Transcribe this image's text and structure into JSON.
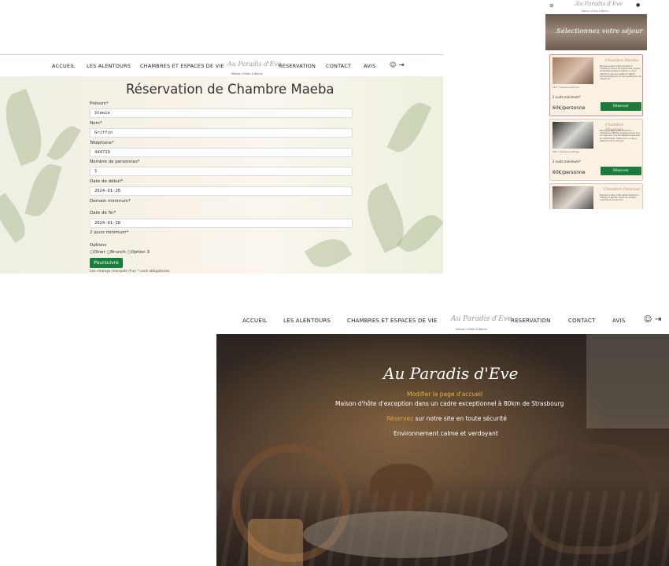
{
  "nav": {
    "items": [
      "ACCUEIL",
      "LES ALENTOURS",
      "CHAMBRES ET ESPACES DE VIE",
      "RESERVATION",
      "CONTACT",
      "AVIS"
    ],
    "logo": "Au Paradis d'Eve",
    "logo_sub": "Maison d'hôte à Bâche",
    "account_icon": "user-circle-icon",
    "logout_icon": "logout-icon"
  },
  "form": {
    "title": "Réservation de Chambre Maeba",
    "fields": [
      {
        "label": "Prénom*",
        "value": "Stewie"
      },
      {
        "label": "Nom*",
        "value": "Griffin"
      },
      {
        "label": "Téléphone*",
        "value": "444719"
      },
      {
        "label": "Nombre de personnes*",
        "value": "1"
      },
      {
        "label": "Date de début*",
        "value": "2024-01-26"
      },
      {
        "label": "Date de fin*",
        "value": "2024-01-28"
      }
    ],
    "hint_start": "Demain minimum*",
    "hint_end": "2 jours minimum*",
    "options_label": "Options",
    "options": [
      "Diner",
      "Brunch",
      "Option 3"
    ],
    "submit": "Poursuivre",
    "footnote": "Les champs marqués d'un * sont obligatoires"
  },
  "mobile": {
    "menu_icon": "hamburger-icon",
    "logo": "Au Paradis d'Eve",
    "logo_sub": "Maison d'hôte à Bâche",
    "hero_title": "Sélectionnez votre séjour",
    "cards": [
      {
        "title": "Chambre Maeba",
        "meta": "19m²   1 personne   wifi logo",
        "min": "2 nuits minimum*",
        "price": "60€/personne",
        "button": "Réserver",
        "text": "Bienvenue dans cette chambre à l'ambiance douce et chaleureuse. Signée de teintes boisées et vieillie, un écrin naturel où des tons sable se mêlent harmonieusement. Un lieu parfait pour se ressourcer."
      },
      {
        "title": "Chambre Magnolia",
        "meta": "20m²   1 personne   wifi logo",
        "min": "2 nuits minimum*",
        "price": "60€/personne",
        "button": "Réserver",
        "text": "Bienvenue dans cette chambre à l'ambiance raffinée, baignée par les tons du magnolia. Une atmosphère apaisante et sophistiquée, idéale pour un séjour détente tout en douceur."
      },
      {
        "title": "Chambre Douceur",
        "meta": "",
        "min": "",
        "price": "",
        "button": "",
        "text": "Bienvenue dans cette petite chambre à l'élégance épurée, pleine de lumière naturelle et de douceur."
      }
    ]
  },
  "home": {
    "title": "Au Paradis d'Eve",
    "edit_link": "Modifier la page d'accueil",
    "line2": "Maison d'hôte d'exception dans un cadre exceptionnel à 80km de Strasbourg",
    "line3_accent": "Réservez",
    "line3_rest": " sur notre site en toute sécurité",
    "line4": "Environnement calme et verdoyant"
  }
}
